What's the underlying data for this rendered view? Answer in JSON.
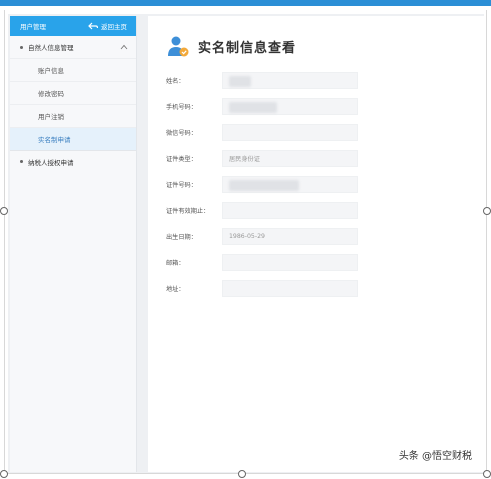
{
  "sidebar": {
    "header_title": "用户管理",
    "back_label": "返回主页",
    "groups": [
      {
        "label": "自然人信息管理",
        "items": [
          {
            "label": "账户信息"
          },
          {
            "label": "修改密码"
          },
          {
            "label": "用户注销"
          },
          {
            "label": "实名制申请"
          }
        ]
      },
      {
        "label": "纳税人授权申请"
      }
    ]
  },
  "main": {
    "title": "实名制信息查看",
    "fields": [
      {
        "label": "姓名：",
        "value": ""
      },
      {
        "label": "手机号码：",
        "value": ""
      },
      {
        "label": "微信号码：",
        "value": ""
      },
      {
        "label": "证件类型：",
        "value": "居民身份证"
      },
      {
        "label": "证件号码：",
        "value": ""
      },
      {
        "label": "证件有效期止：",
        "value": ""
      },
      {
        "label": "出生日期：",
        "value": "1986-05-29"
      },
      {
        "label": "邮箱：",
        "value": ""
      },
      {
        "label": "地址：",
        "value": ""
      }
    ]
  },
  "watermark": "头条 @悟空财税",
  "colors": {
    "accent": "#29a3ea",
    "top_bar": "#2b8fd6",
    "active_item_bg": "#e5f1fb"
  }
}
